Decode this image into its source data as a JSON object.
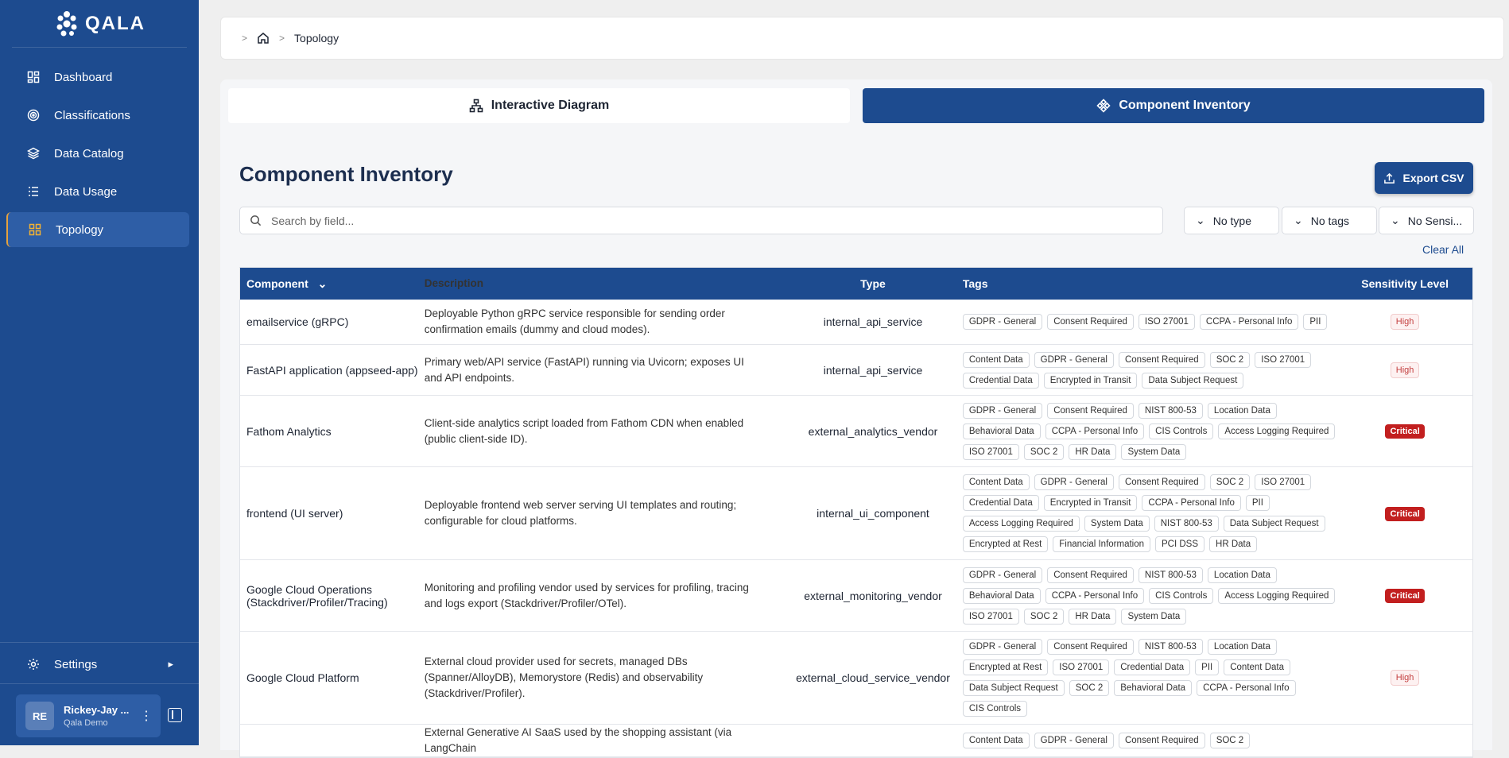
{
  "app": {
    "logo_text": "QALA"
  },
  "sidebar": {
    "items": [
      {
        "label": "Dashboard",
        "icon": "dashboard-icon"
      },
      {
        "label": "Classifications",
        "icon": "target-icon"
      },
      {
        "label": "Data Catalog",
        "icon": "layers-icon"
      },
      {
        "label": "Data Usage",
        "icon": "list-icon"
      },
      {
        "label": "Topology",
        "icon": "topology-icon"
      }
    ],
    "settings_label": "Settings",
    "user": {
      "initials": "RE",
      "name": "Rickey-Jay ...",
      "org": "Qala Demo"
    }
  },
  "breadcrumb": {
    "current": "Topology"
  },
  "tabs": [
    {
      "label": "Interactive Diagram"
    },
    {
      "label": "Component Inventory"
    }
  ],
  "inventory": {
    "title": "Component Inventory",
    "export_label": "Export CSV",
    "search_placeholder": "Search by field...",
    "filters": [
      "No type",
      "No tags",
      "No Sensi..."
    ],
    "clear_label": "Clear All",
    "columns": [
      "Component",
      "Description",
      "Type",
      "Tags",
      "Sensitivity Level"
    ],
    "rows": [
      {
        "component": "emailservice (gRPC)",
        "description": "Deployable Python gRPC service responsible for sending order confirmation emails (dummy and cloud modes).",
        "type": "internal_api_service",
        "tags": [
          "GDPR - General",
          "Consent Required",
          "ISO 27001",
          "CCPA - Personal Info",
          "PII"
        ],
        "sensitivity": "High"
      },
      {
        "component": "FastAPI application (appseed-app)",
        "description": "Primary web/API service (FastAPI) running via Uvicorn; exposes UI and API endpoints.",
        "type": "internal_api_service",
        "tags": [
          "Content Data",
          "GDPR - General",
          "Consent Required",
          "SOC 2",
          "ISO 27001",
          "Credential Data",
          "Encrypted in Transit",
          "Data Subject Request"
        ],
        "sensitivity": "High"
      },
      {
        "component": "Fathom Analytics",
        "description": "Client-side analytics script loaded from Fathom CDN when enabled (public client-side ID).",
        "type": "external_analytics_vendor",
        "tags": [
          "GDPR - General",
          "Consent Required",
          "NIST 800-53",
          "Location Data",
          "Behavioral Data",
          "CCPA - Personal Info",
          "CIS Controls",
          "Access Logging Required",
          "ISO 27001",
          "SOC 2",
          "HR Data",
          "System Data"
        ],
        "sensitivity": "Critical"
      },
      {
        "component": "frontend (UI server)",
        "description": "Deployable frontend web server serving UI templates and routing; configurable for cloud platforms.",
        "type": "internal_ui_component",
        "tags": [
          "Content Data",
          "GDPR - General",
          "Consent Required",
          "SOC 2",
          "ISO 27001",
          "Credential Data",
          "Encrypted in Transit",
          "CCPA - Personal Info",
          "PII",
          "Access Logging Required",
          "System Data",
          "NIST 800-53",
          "Data Subject Request",
          "Encrypted at Rest",
          "Financial Information",
          "PCI DSS",
          "HR Data"
        ],
        "sensitivity": "Critical"
      },
      {
        "component": "Google Cloud Operations (Stackdriver/Profiler/Tracing)",
        "description": "Monitoring and profiling vendor used by services for profiling, tracing and logs export (Stackdriver/Profiler/OTel).",
        "type": "external_monitoring_vendor",
        "tags": [
          "GDPR - General",
          "Consent Required",
          "NIST 800-53",
          "Location Data",
          "Behavioral Data",
          "CCPA - Personal Info",
          "CIS Controls",
          "Access Logging Required",
          "ISO 27001",
          "SOC 2",
          "HR Data",
          "System Data"
        ],
        "sensitivity": "Critical"
      },
      {
        "component": "Google Cloud Platform",
        "description": "External cloud provider used for secrets, managed DBs (Spanner/AlloyDB), Memorystore (Redis) and observability (Stackdriver/Profiler).",
        "type": "external_cloud_service_vendor",
        "tags": [
          "GDPR - General",
          "Consent Required",
          "NIST 800-53",
          "Location Data",
          "Encrypted at Rest",
          "ISO 27001",
          "Credential Data",
          "PII",
          "Content Data",
          "Data Subject Request",
          "SOC 2",
          "Behavioral Data",
          "CCPA - Personal Info",
          "CIS Controls"
        ],
        "sensitivity": "High"
      },
      {
        "component": "",
        "description": "External Generative AI SaaS used by the shopping assistant (via LangChain",
        "type": "",
        "tags": [
          "Content Data",
          "GDPR - General",
          "Consent Required",
          "SOC 2"
        ],
        "sensitivity": ""
      }
    ]
  }
}
